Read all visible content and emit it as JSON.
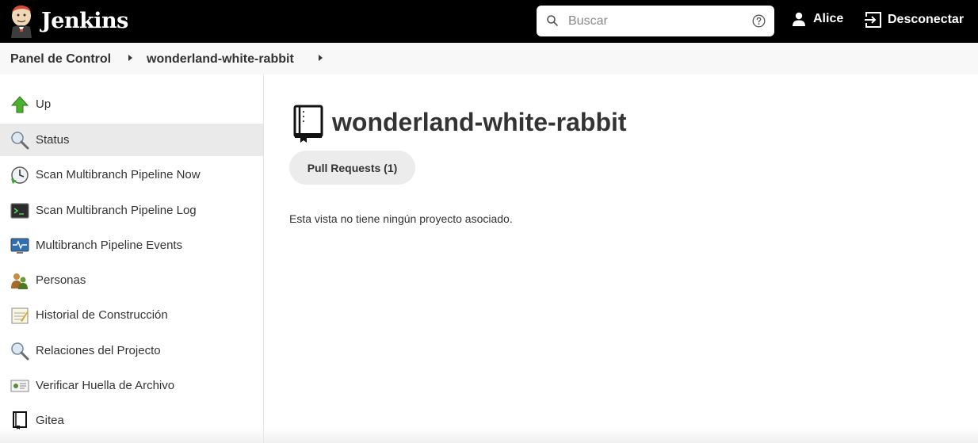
{
  "header": {
    "brand": "Jenkins",
    "search_placeholder": "Buscar",
    "search_value": "",
    "user_name": "Alice",
    "logout_label": "Desconectar"
  },
  "breadcrumb": {
    "items": [
      {
        "label": "Panel de Control"
      },
      {
        "label": "wonderland-white-rabbit"
      }
    ]
  },
  "sidebar": {
    "items": [
      {
        "label": "Up",
        "icon": "up-arrow-icon"
      },
      {
        "label": "Status",
        "icon": "search-icon"
      },
      {
        "label": "Scan Multibranch Pipeline Now",
        "icon": "clock-icon"
      },
      {
        "label": "Scan Multibranch Pipeline Log",
        "icon": "terminal-icon"
      },
      {
        "label": "Multibranch Pipeline Events",
        "icon": "monitor-icon"
      },
      {
        "label": "Personas",
        "icon": "people-icon"
      },
      {
        "label": "Historial de Construcción",
        "icon": "notepad-icon"
      },
      {
        "label": "Relaciones del Projecto",
        "icon": "search-icon"
      },
      {
        "label": "Verificar Huella de Archivo",
        "icon": "fingerprint-icon"
      },
      {
        "label": "Gitea",
        "icon": "book-icon"
      }
    ],
    "active_index": 1
  },
  "main": {
    "title": "wonderland-white-rabbit",
    "tabs": [
      {
        "label": "Pull Requests (1)"
      }
    ],
    "empty_message": "Esta vista no tiene ningún proyecto asociado."
  },
  "colors": {
    "header_bg": "#000000",
    "breadcrumb_bg": "#f8f8f8",
    "active_item_bg": "#eaeaea",
    "tab_bg": "#ececec"
  }
}
